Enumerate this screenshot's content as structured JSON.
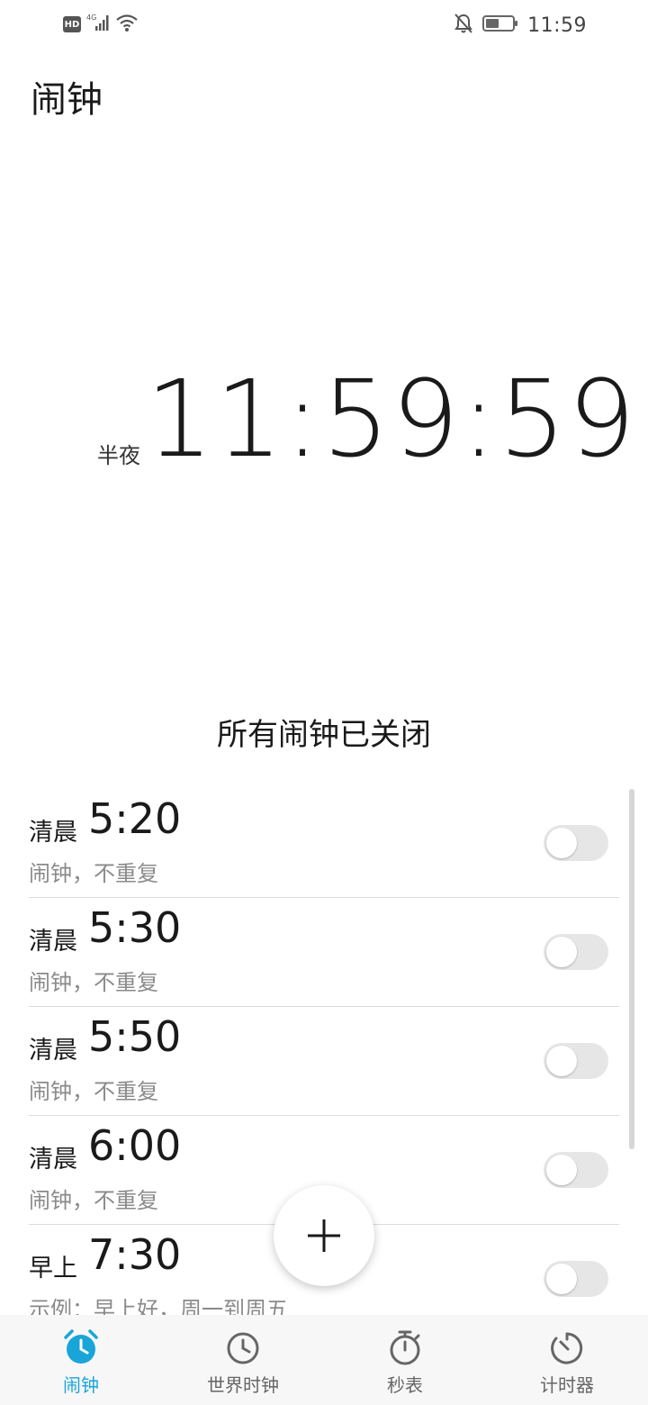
{
  "status_bar": {
    "hd": "HD",
    "network": "4G",
    "time": "11:59"
  },
  "app": {
    "title": "闹钟"
  },
  "clock": {
    "period": "半夜",
    "time": "11:59:59"
  },
  "alarm_status": "所有闹钟已关闭",
  "alarms": [
    {
      "period": "清晨",
      "time": "5:20",
      "subtitle": "闹钟，不重复",
      "enabled": false
    },
    {
      "period": "清晨",
      "time": "5:30",
      "subtitle": "闹钟，不重复",
      "enabled": false
    },
    {
      "period": "清晨",
      "time": "5:50",
      "subtitle": "闹钟，不重复",
      "enabled": false
    },
    {
      "period": "清晨",
      "time": "6:00",
      "subtitle": "闹钟，不重复",
      "enabled": false
    },
    {
      "period": "早上",
      "time": "7:30",
      "subtitle": "示例：早上好，周一到周五",
      "enabled": false
    }
  ],
  "fab": {
    "icon": "plus-icon"
  },
  "nav": [
    {
      "label": "闹钟",
      "icon": "alarm-clock-icon",
      "active": true
    },
    {
      "label": "世界时钟",
      "icon": "clock-icon",
      "active": false
    },
    {
      "label": "秒表",
      "icon": "stopwatch-icon",
      "active": false
    },
    {
      "label": "计时器",
      "icon": "timer-icon",
      "active": false
    }
  ],
  "colors": {
    "accent": "#1aa5d9",
    "toggle_off": "#e6e6e6",
    "divider": "#dcdcdc"
  }
}
